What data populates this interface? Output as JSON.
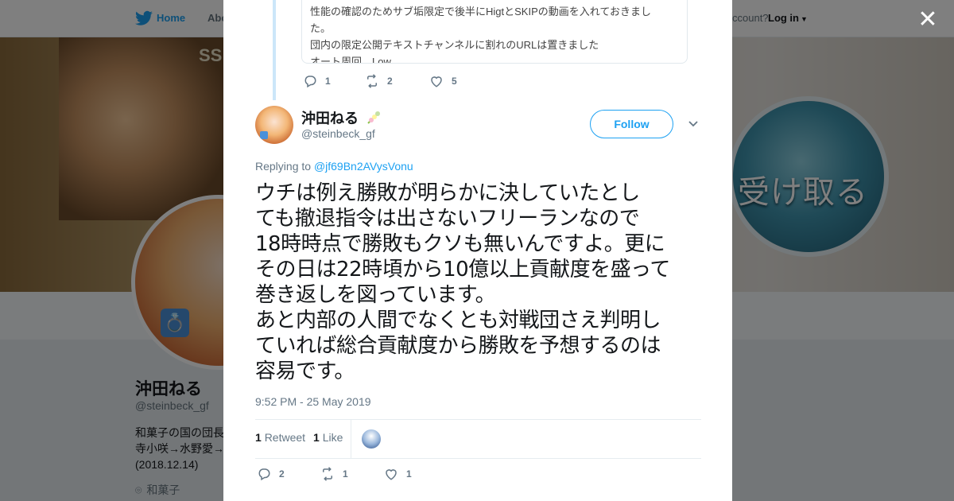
{
  "background": {
    "nav": {
      "home": "Home",
      "about": "Abo",
      "account": "ccount?",
      "login": "Log in"
    },
    "banner_tag": "SS",
    "banner_button_text": "受け取る",
    "profile": {
      "name": "沖田ねる",
      "handle": "@steinbeck_gf",
      "bio_lines": [
        "和菓子の国の団長",
        "寺小咲→水野愛→",
        "(2018.12.14)"
      ],
      "location": "和菓子"
    }
  },
  "modal": {
    "quoted_lines": [
      "性能の確認のためサブ垢限定で後半にHigtとSKIPの動画を入れておきまし",
      "た。",
      "団内の限定公開テキストチャンネルに割れのURLは置きました",
      "オート周回　Low"
    ],
    "parent_actions": {
      "replies": "1",
      "retweets": "2",
      "likes": "5"
    },
    "author": {
      "name": "沖田ねる",
      "handle": "@steinbeck_gf"
    },
    "follow_label": "Follow",
    "replying_prefix": "Replying to",
    "replying_to": "@jf69Bn2AVysVonu",
    "tweet_lines": [
      "ウチは例え勝敗が明らかに決していたとし",
      "ても撤退指令は出さないフリーランなので",
      "18時時点で勝敗もクソも無いんですよ。更に",
      "その日は22時頃から10億以上貢献度を盛って",
      "巻き返しを図っています。",
      "あと内部の人間でなくとも対戦団さえ判明し",
      "ていれば総合貢献度から勝敗を予想するのは",
      "容易です。"
    ],
    "timestamp": "9:52 PM - 25 May 2019",
    "stats": {
      "retweet_count": "1",
      "retweet_label": "Retweet",
      "like_count": "1",
      "like_label": "Like"
    },
    "actions": {
      "replies": "2",
      "retweets": "1",
      "likes": "1"
    }
  },
  "icons": [
    "twitter-bird-icon",
    "caret-down-icon",
    "close-icon",
    "reply-icon",
    "retweet-icon",
    "heart-icon",
    "chevron-down-icon",
    "location-pin-icon",
    "flower-emoji-icon",
    "ring-emoji-icon"
  ],
  "colors": {
    "accent": "#1da1f2",
    "text": "#14171a",
    "muted": "#657786",
    "thread_line": "#cce6f9"
  }
}
